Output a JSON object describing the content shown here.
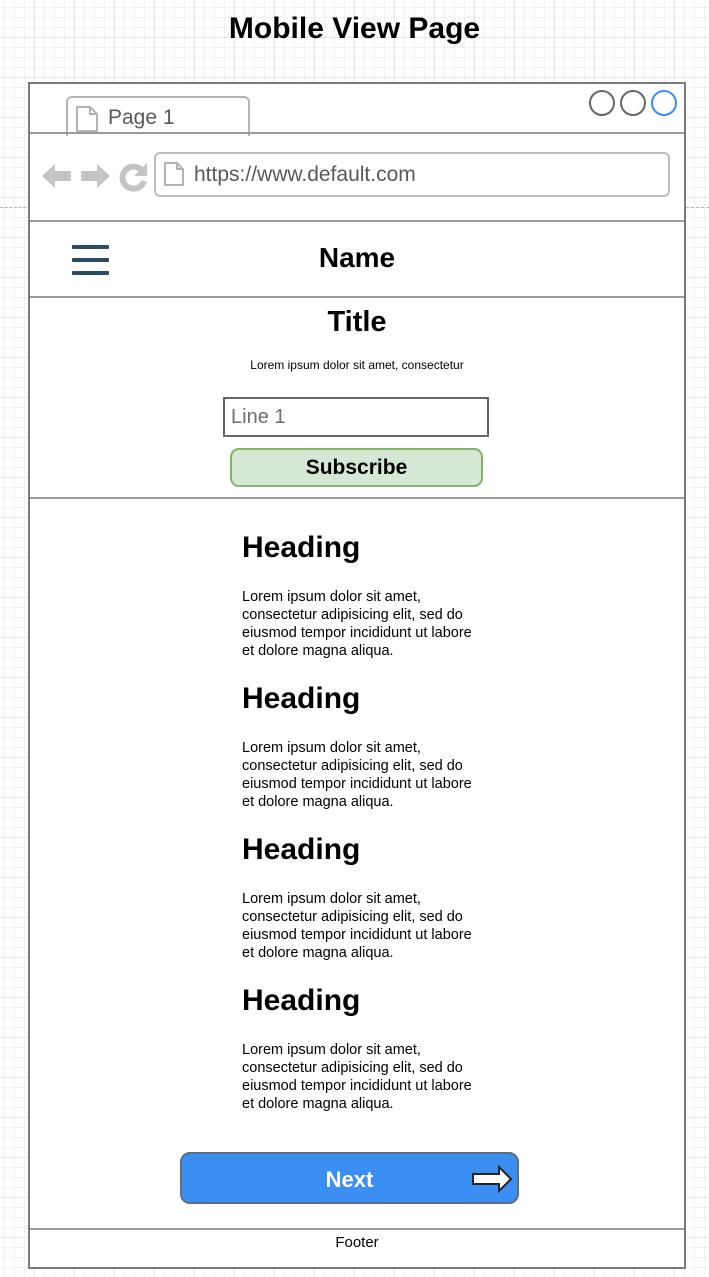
{
  "page_title": "Mobile View Page",
  "browser": {
    "tab_label": "Page 1",
    "url": "https://www.default.com"
  },
  "app_header": {
    "name": "Name"
  },
  "hero": {
    "title": "Title",
    "subtitle": "Lorem ipsum dolor sit amet, consectetur",
    "input_placeholder": "Line 1",
    "subscribe_label": "Subscribe"
  },
  "articles": [
    {
      "heading": "Heading",
      "body": "Lorem ipsum dolor sit amet, consectetur adipisicing elit, sed do eiusmod tempor incididunt ut labore et dolore magna aliqua."
    },
    {
      "heading": "Heading",
      "body": "Lorem ipsum dolor sit amet, consectetur adipisicing elit, sed do eiusmod tempor incididunt ut labore et dolore magna aliqua."
    },
    {
      "heading": "Heading",
      "body": "Lorem ipsum dolor sit amet, consectetur adipisicing elit, sed do eiusmod tempor incididunt ut labore et dolore magna aliqua."
    },
    {
      "heading": "Heading",
      "body": "Lorem ipsum dolor sit amet, consectetur adipisicing elit, sed do eiusmod tempor incididunt ut labore et dolore magna aliqua."
    }
  ],
  "next_label": "Next",
  "footer": "Footer",
  "icons": {
    "tab": "document-icon",
    "back": "arrow-left-icon",
    "forward": "arrow-right-icon",
    "reload": "reload-icon",
    "menu": "hamburger-menu-icon",
    "next": "arrow-right-outline-icon"
  },
  "colors": {
    "subscribe_fill": "#d5e8d4",
    "subscribe_border": "#82b366",
    "next_fill": "#3b8ef2",
    "hamburger": "#2d4a63",
    "active_window_button": "#3a8ef0"
  }
}
